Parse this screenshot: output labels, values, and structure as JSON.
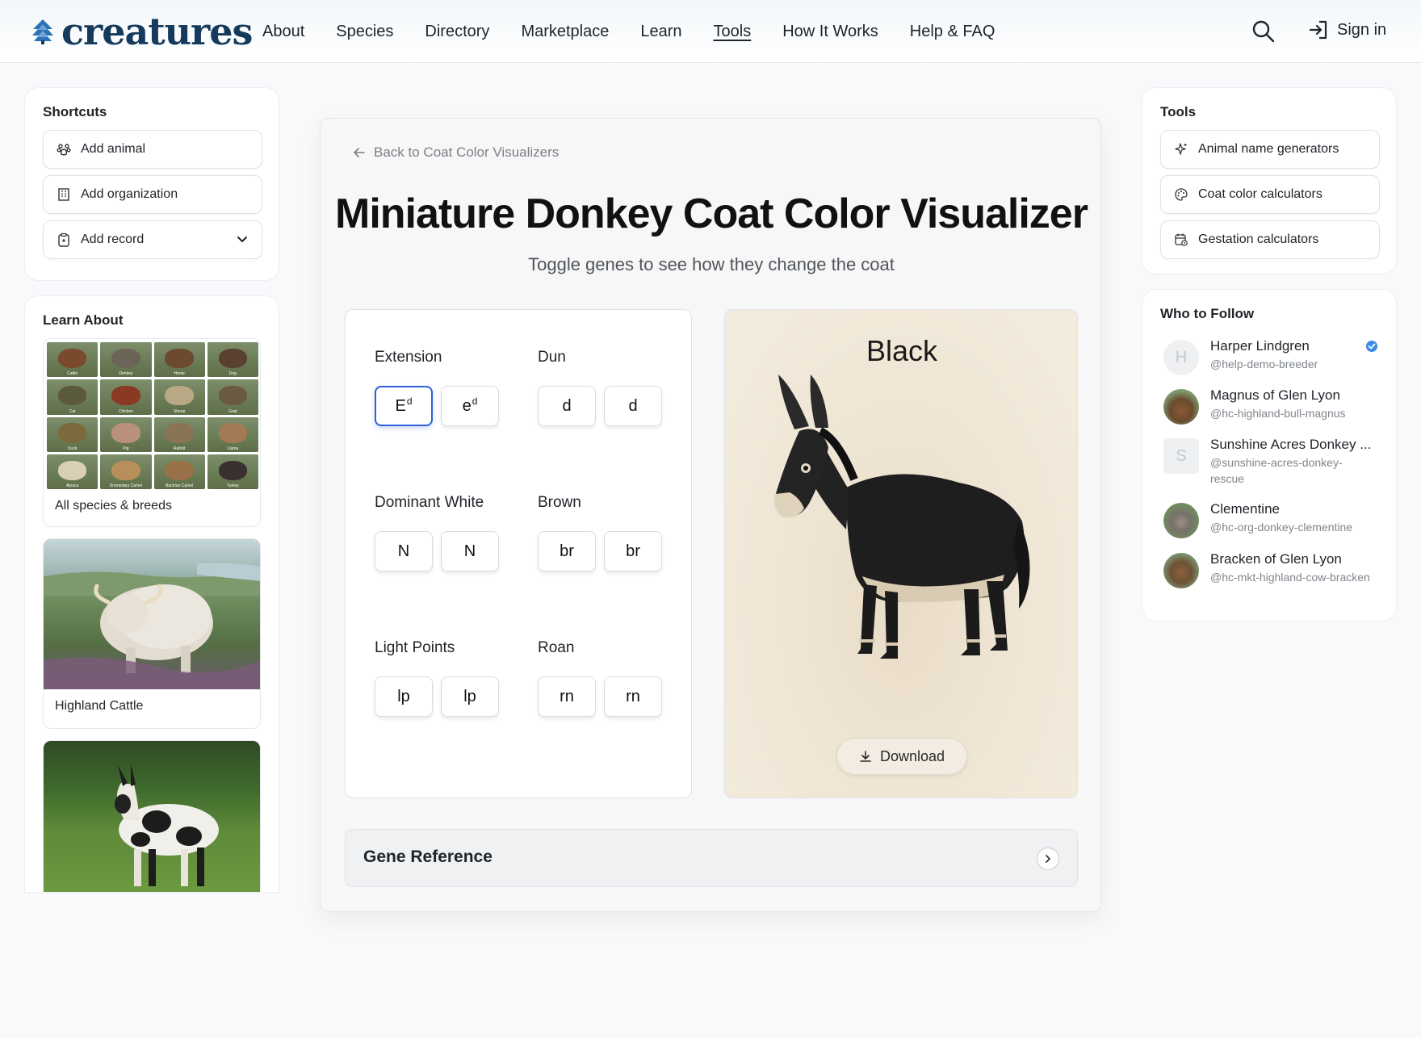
{
  "brand": {
    "name": "creatures"
  },
  "nav": {
    "links": [
      "About",
      "Species",
      "Directory",
      "Marketplace",
      "Learn",
      "Tools",
      "How It Works",
      "Help & FAQ"
    ],
    "active": "Tools",
    "signin": "Sign in"
  },
  "shortcuts": {
    "title": "Shortcuts",
    "items": [
      {
        "label": "Add animal",
        "icon": "paw-icon"
      },
      {
        "label": "Add organization",
        "icon": "building-icon"
      },
      {
        "label": "Add record",
        "icon": "clipboard-icon"
      }
    ]
  },
  "learn": {
    "title": "Learn About",
    "species_grid": [
      "Cattle",
      "Donkey",
      "Horse",
      "Dog",
      "Cat",
      "Chicken",
      "Sheep",
      "Goat",
      "Duck",
      "Pig",
      "Rabbit",
      "Llama",
      "Alpaca",
      "Dromedary Camel",
      "Bactrian Camel",
      "Turkey"
    ],
    "tiles": [
      {
        "label": "All species & breeds"
      },
      {
        "label": "Highland Cattle"
      },
      {
        "label": ""
      }
    ]
  },
  "main": {
    "back": "Back to Coat Color Visualizers",
    "title": "Miniature Donkey Coat Color Visualizer",
    "subtitle": "Toggle genes to see how they change the coat",
    "genes": [
      {
        "name": "Extension",
        "alleles": [
          {
            "base": "E",
            "sup": "d",
            "selected": true
          },
          {
            "base": "e",
            "sup": "d",
            "selected": false
          }
        ]
      },
      {
        "name": "Dun",
        "alleles": [
          {
            "base": "d",
            "sup": ""
          },
          {
            "base": "d",
            "sup": ""
          }
        ]
      },
      {
        "name": "Dominant White",
        "alleles": [
          {
            "base": "N",
            "sup": ""
          },
          {
            "base": "N",
            "sup": ""
          }
        ]
      },
      {
        "name": "Brown",
        "alleles": [
          {
            "base": "br",
            "sup": ""
          },
          {
            "base": "br",
            "sup": ""
          }
        ]
      },
      {
        "name": "Light Points",
        "alleles": [
          {
            "base": "lp",
            "sup": ""
          },
          {
            "base": "lp",
            "sup": ""
          }
        ]
      },
      {
        "name": "Roan",
        "alleles": [
          {
            "base": "rn",
            "sup": ""
          },
          {
            "base": "rn",
            "sup": ""
          }
        ]
      }
    ],
    "preview": {
      "color_name": "Black",
      "download": "Download"
    },
    "gene_reference": "Gene Reference"
  },
  "tools": {
    "title": "Tools",
    "items": [
      {
        "label": "Animal name generators",
        "icon": "sparkle-icon"
      },
      {
        "label": "Coat color calculators",
        "icon": "palette-icon"
      },
      {
        "label": "Gestation calculators",
        "icon": "calendar-icon"
      }
    ]
  },
  "follow": {
    "title": "Who to Follow",
    "people": [
      {
        "name": "Harper Lindgren",
        "handle": "@help-demo-breeder",
        "initial": "H",
        "verified": true
      },
      {
        "name": "Magnus of Glen Lyon",
        "handle": "@hc-highland-bull-magnus",
        "initial": "",
        "verified": false
      },
      {
        "name": "Sunshine Acres Donkey ...",
        "handle": "@sunshine-acres-donkey-rescue",
        "initial": "S",
        "verified": false
      },
      {
        "name": "Clementine",
        "handle": "@hc-org-donkey-clementine",
        "initial": "",
        "verified": false
      },
      {
        "name": "Bracken of Glen Lyon",
        "handle": "@hc-mkt-highland-cow-bracken",
        "initial": "",
        "verified": false
      }
    ]
  },
  "colors": {
    "accent": "#2f62d9",
    "brand": "#153a5c",
    "verified": "#3b8bea"
  }
}
